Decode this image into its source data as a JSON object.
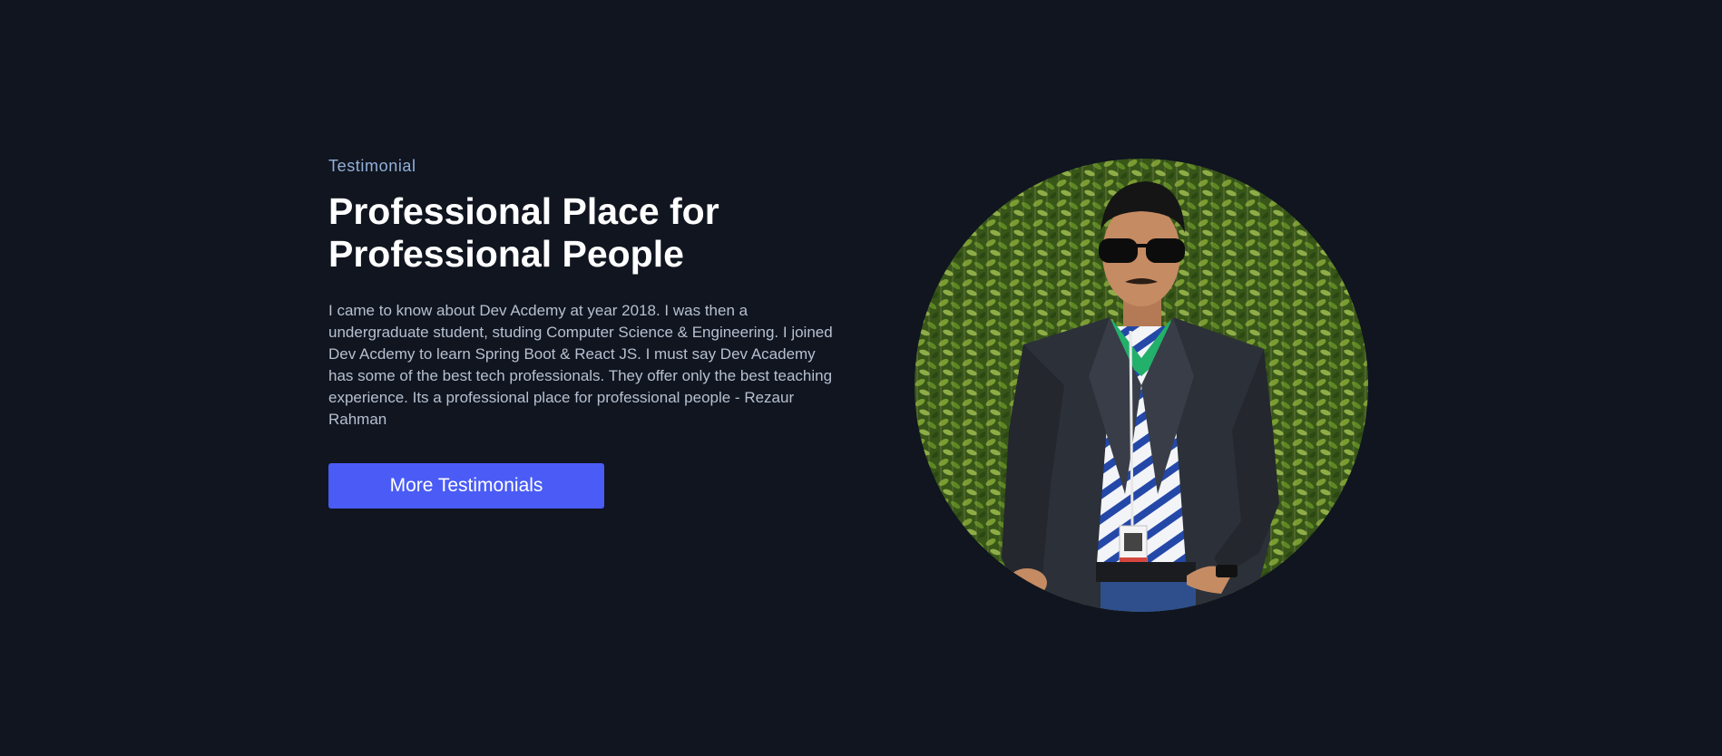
{
  "testimonial": {
    "eyebrow": "Testimonial",
    "title_line_1": "Professional Place for",
    "title_line_2": "Professional People",
    "quote": "I came to know about Dev Acdemy at year 2018. I was then a undergraduate student, studing Computer Science & Engineering. I joined Dev Acdemy to learn Spring Boot & React JS. I must say Dev Academy has some of the best tech professionals. They offer only the best teaching experience. Its a professional place for professional people - Rezaur Rahman",
    "button_label": "More Testimonials"
  },
  "colors": {
    "background": "#101520",
    "eyebrow": "#93b0d8",
    "button": "#4a5cf5"
  },
  "image": {
    "icon": "person-portrait-photo"
  }
}
